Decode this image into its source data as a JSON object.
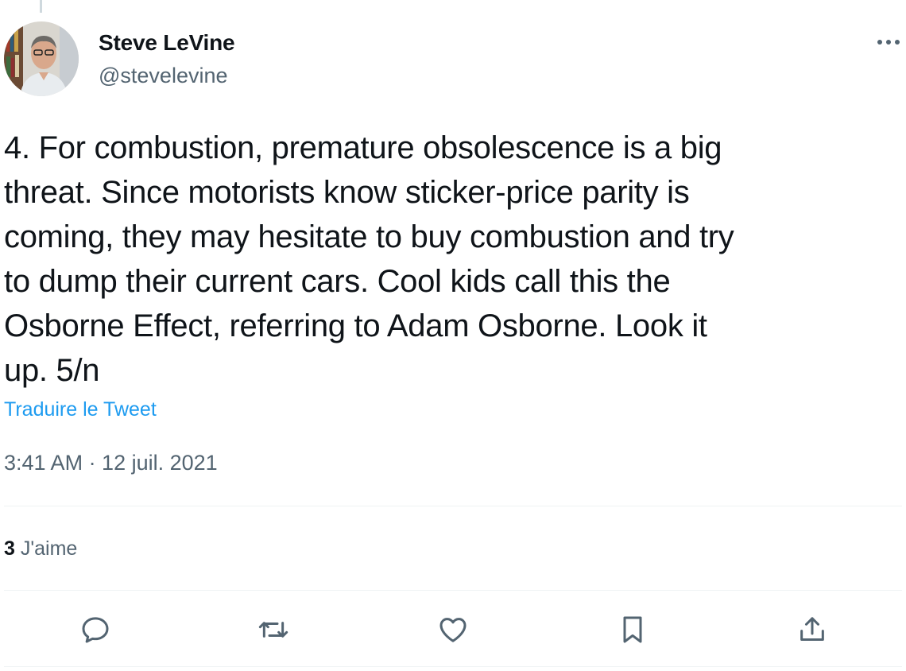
{
  "author": {
    "name": "Steve LeVine",
    "handle": "@stevelevine"
  },
  "tweet": {
    "text_lines": [
      "4. For combustion, premature obsolescence is a big",
      "threat. Since motorists know sticker-price parity is",
      "coming, they may hesitate to buy combustion and try",
      "to dump their current cars. Cool kids call this the",
      "Osborne Effect, referring to Adam Osborne. Look it",
      "up. 5/n"
    ],
    "translate_label": "Traduire le Tweet",
    "timestamp": "3:41 AM · 12 juil. 2021"
  },
  "stats": {
    "likes_count": "3",
    "likes_label": "J'aime"
  },
  "icons": {
    "more": "more-icon",
    "reply": "reply-icon",
    "retweet": "retweet-icon",
    "like": "heart-icon",
    "bookmark": "bookmark-icon",
    "share": "share-icon"
  },
  "colors": {
    "text": "#0f1419",
    "secondary": "#536471",
    "link": "#1d9bf0",
    "divider": "#eff3f4"
  }
}
